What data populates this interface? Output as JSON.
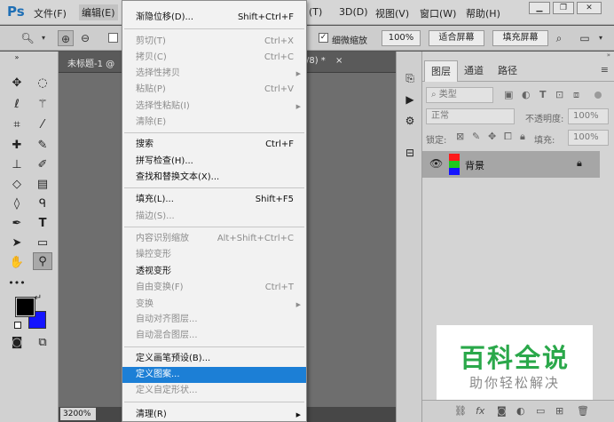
{
  "app": {
    "logo": "Ps"
  },
  "menubar": {
    "items": [
      "文件(F)",
      "编辑(E)",
      "(T)",
      "3D(D)",
      "视图(V)",
      "窗口(W)",
      "帮助(H)"
    ]
  },
  "window_controls": {
    "minimize": "▁",
    "restore": "❐",
    "close": "✕"
  },
  "options": {
    "fine_zoom_label": "细微缩放",
    "fine_zoom_checked": true,
    "zoom_value": "100%",
    "fit_screen": "适合屏幕",
    "fill_screen": "填充屏幕"
  },
  "document": {
    "tab_left": "未标题-1 @",
    "tab_right": "/8) *",
    "tab_close": "×",
    "zoom_level": "3200%"
  },
  "edit_menu": {
    "fade": {
      "label": "渐隐位移(D)...",
      "shortcut": "Shift+Ctrl+F"
    },
    "cut": {
      "label": "剪切(T)",
      "shortcut": "Ctrl+X"
    },
    "copy": {
      "label": "拷贝(C)",
      "shortcut": "Ctrl+C"
    },
    "copy_merged": {
      "label": "选择性拷贝"
    },
    "paste": {
      "label": "粘贴(P)",
      "shortcut": "Ctrl+V"
    },
    "paste_special": {
      "label": "选择性粘贴(I)"
    },
    "clear": {
      "label": "清除(E)"
    },
    "search": {
      "label": "搜索",
      "shortcut": "Ctrl+F"
    },
    "spell_check": {
      "label": "拼写检查(H)..."
    },
    "find_replace": {
      "label": "查找和替换文本(X)..."
    },
    "fill": {
      "label": "填充(L)...",
      "shortcut": "Shift+F5"
    },
    "stroke": {
      "label": "描边(S)..."
    },
    "content_aware_scale": {
      "label": "内容识别缩放",
      "shortcut": "Alt+Shift+Ctrl+C"
    },
    "puppet_warp": {
      "label": "操控变形"
    },
    "perspective_warp": {
      "label": "透视变形"
    },
    "free_transform": {
      "label": "自由变换(F)",
      "shortcut": "Ctrl+T"
    },
    "transform": {
      "label": "变换"
    },
    "auto_align": {
      "label": "自动对齐图层..."
    },
    "auto_blend": {
      "label": "自动混合图层..."
    },
    "define_brush": {
      "label": "定义画笔预设(B)..."
    },
    "define_pattern": {
      "label": "定义图案..."
    },
    "define_shape": {
      "label": "定义自定形状..."
    },
    "purge": {
      "label": "清理(R)"
    }
  },
  "layers_panel": {
    "tabs": [
      "图层",
      "通道",
      "路径"
    ],
    "filter_kind": "类型",
    "blend_mode": "正常",
    "opacity_label": "不透明度:",
    "opacity_value": "100%",
    "lock_label": "锁定:",
    "fill_label": "填充:",
    "fill_value": "100%",
    "layer_name": "背景"
  },
  "watermark": {
    "title": "百科全说",
    "subtitle": "助你轻松解决"
  },
  "colors": {
    "highlight": "#1c7fd6",
    "foreground": "#000000",
    "background": "#1414ff",
    "watermark_green": "#2aa84a"
  },
  "icons": [
    "move-icon",
    "marquee-icon",
    "lasso-icon",
    "magic-wand-icon",
    "crop-icon",
    "eyedropper-icon",
    "healing-icon",
    "brush-icon",
    "stamp-icon",
    "history-brush-icon",
    "eraser-icon",
    "gradient-icon",
    "blur-icon",
    "dodge-icon",
    "pen-icon",
    "type-icon",
    "path-select-icon",
    "rectangle-icon",
    "hand-icon",
    "zoom-icon"
  ]
}
